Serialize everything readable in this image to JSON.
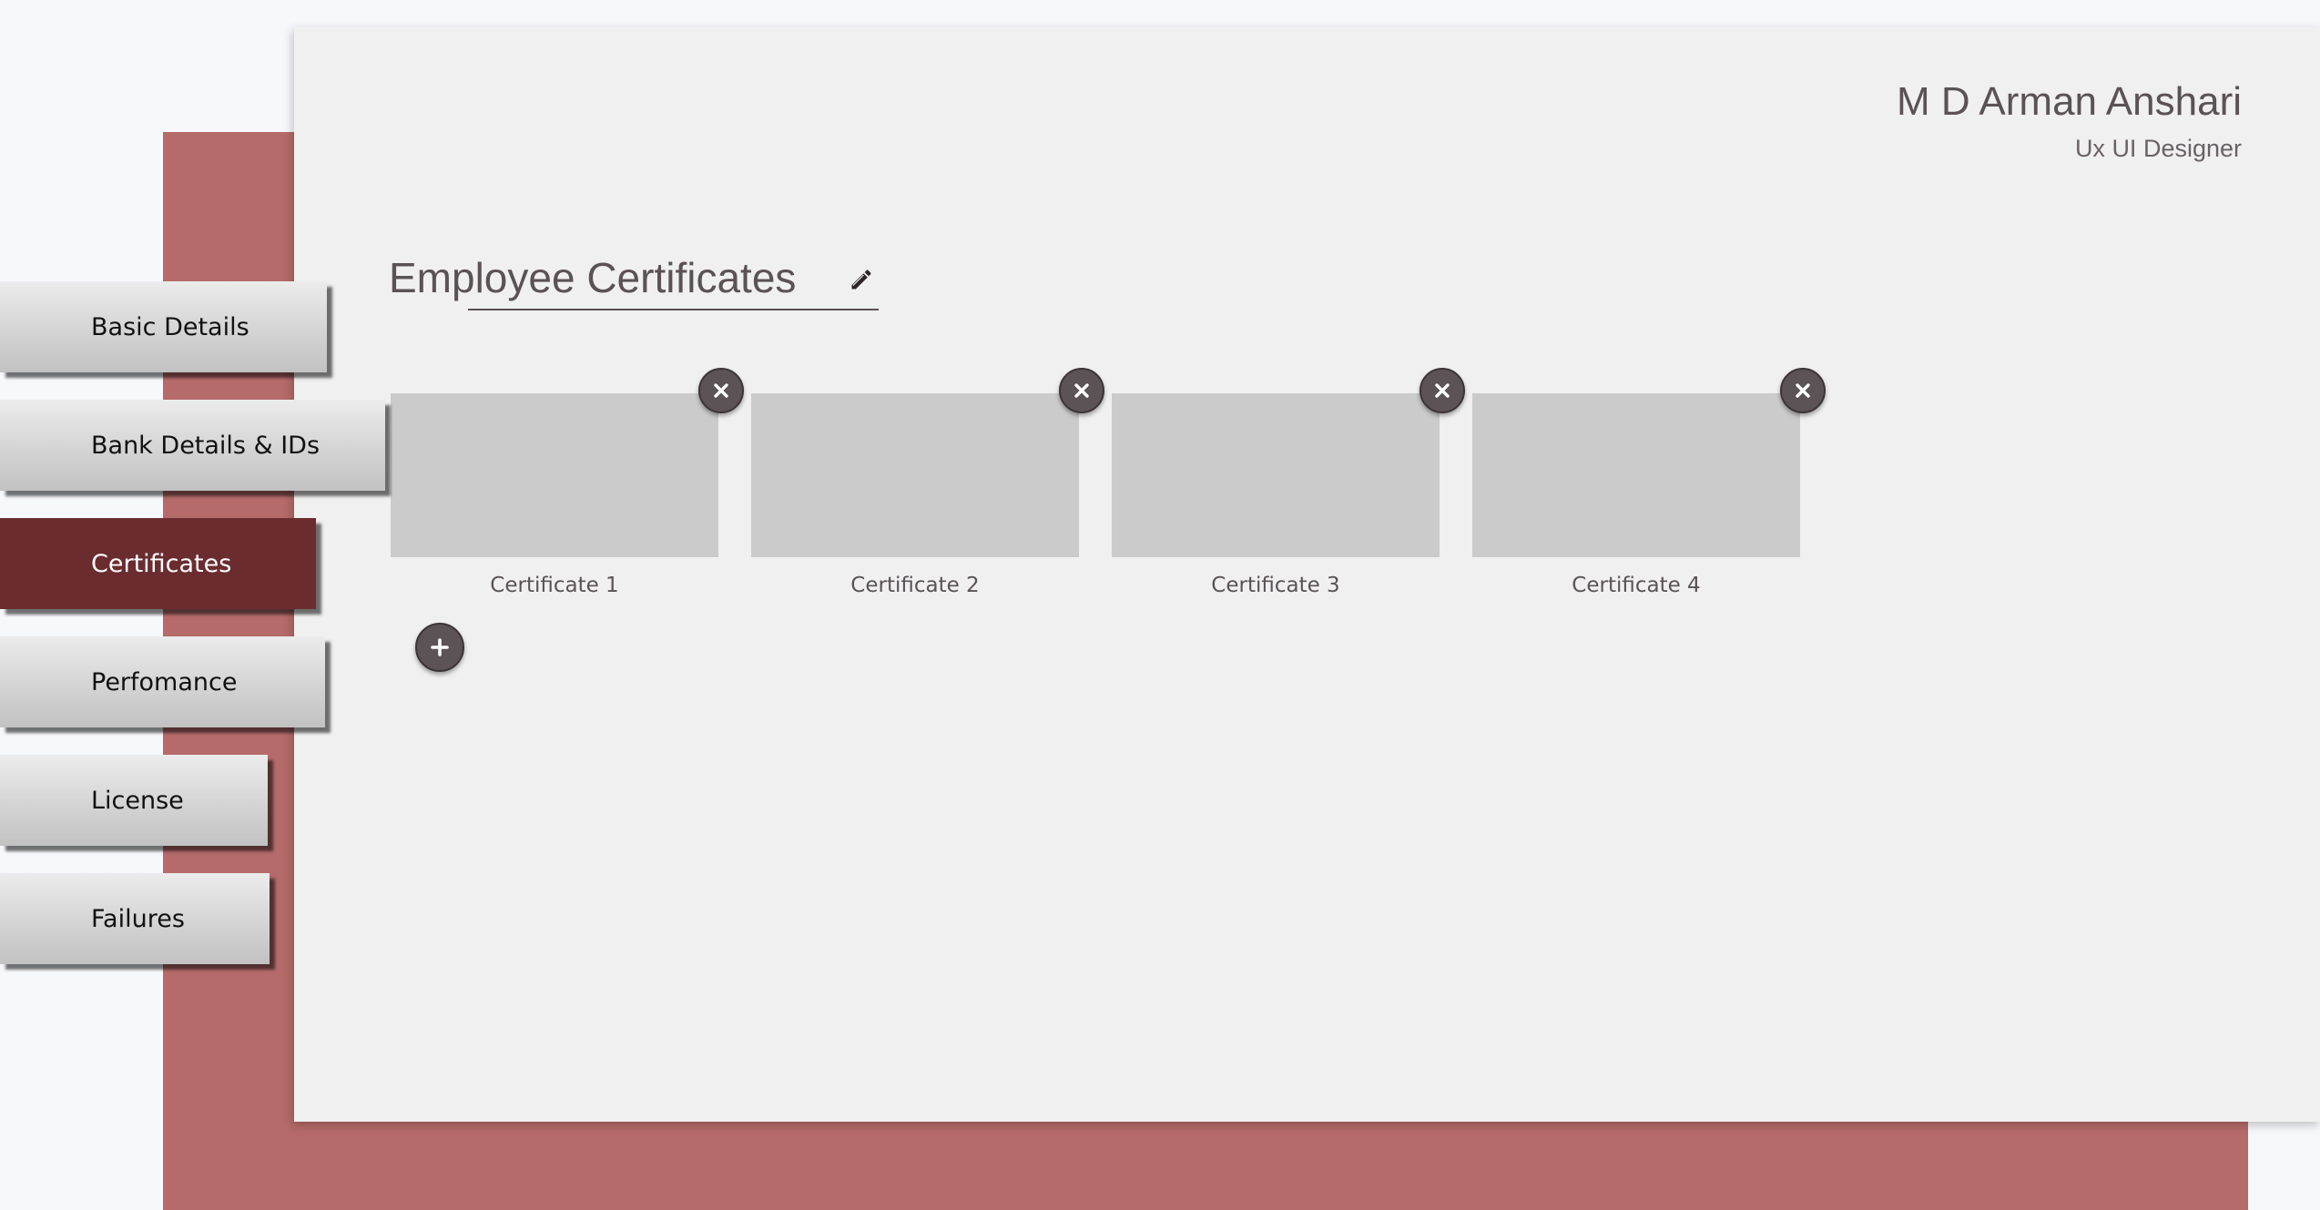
{
  "header": {
    "user_name": "M D Arman Anshari",
    "user_role": "Ux UI Designer"
  },
  "section": {
    "title": "Employee Certificates"
  },
  "sidebar": {
    "items": [
      {
        "label": "Basic Details"
      },
      {
        "label": "Bank Details & IDs"
      },
      {
        "label": "Certificates",
        "active": true
      },
      {
        "label": "Perfomance"
      },
      {
        "label": "License"
      },
      {
        "label": "Failures"
      }
    ]
  },
  "certificates": [
    {
      "label": "Certificate 1"
    },
    {
      "label": "Certificate 2"
    },
    {
      "label": "Certificate 3"
    },
    {
      "label": "Certificate 4"
    }
  ],
  "icons": {
    "edit": "pencil-icon",
    "remove": "close-icon",
    "add": "plus-icon"
  },
  "colors": {
    "accent_active_tab": "#6b2c30",
    "backdrop": "#b56b6a",
    "card_background": "#f0f0f0",
    "button_dark": "#5c5356",
    "thumbnail": "#cbcbcb"
  }
}
